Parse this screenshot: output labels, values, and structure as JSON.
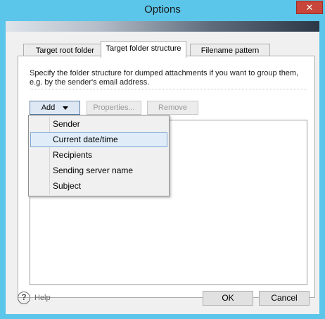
{
  "window": {
    "title": "Options",
    "close_glyph": "✕"
  },
  "tabs": [
    {
      "label": "Target root folder"
    },
    {
      "label": "Target folder structure"
    },
    {
      "label": "Filename pattern"
    }
  ],
  "panel": {
    "description": "Specify the folder structure for dumped attachments if you want to group them, e.g. by the sender's email address."
  },
  "toolbar": {
    "add_label": "Add",
    "properties_label": "Properties...",
    "remove_label": "Remove"
  },
  "add_menu": {
    "items": [
      {
        "label": "Sender"
      },
      {
        "label": "Current date/time"
      },
      {
        "label": "Recipients"
      },
      {
        "label": "Sending server name"
      },
      {
        "label": "Subject"
      }
    ],
    "highlighted_label": "Current date/time"
  },
  "footer": {
    "help_glyph": "?",
    "help_label": "Help",
    "ok_label": "OK",
    "cancel_label": "Cancel"
  }
}
